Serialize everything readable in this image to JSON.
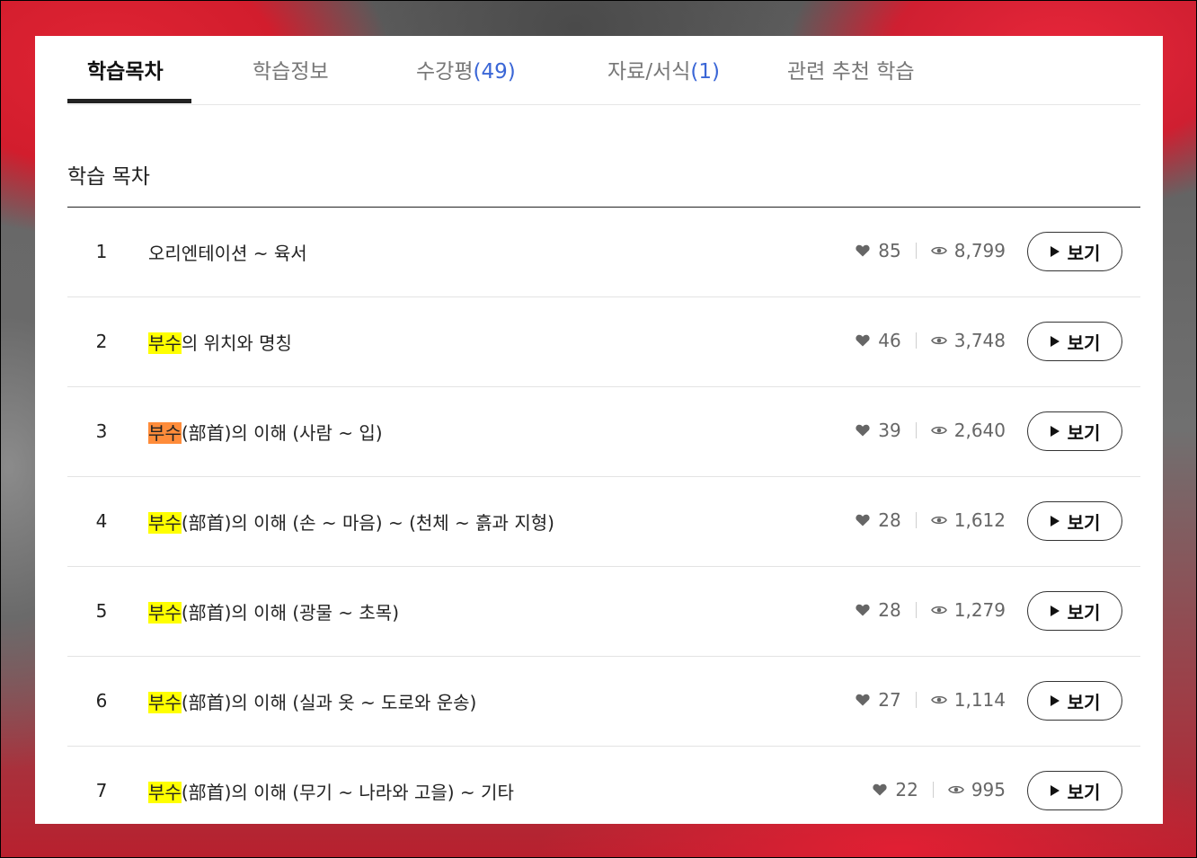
{
  "tabs": [
    {
      "label": "학습목차",
      "count": "",
      "active": true
    },
    {
      "label": "학습정보",
      "count": "",
      "active": false
    },
    {
      "label": "수강평",
      "count": "(49)",
      "active": false
    },
    {
      "label": "자료/서식",
      "count": "(1)",
      "active": false
    },
    {
      "label": "관련 추천 학습",
      "count": "",
      "active": false
    }
  ],
  "section_title": "학습 목차",
  "view_label": "보기",
  "highlight_colors": {
    "yellow": "#ffff00",
    "orange": "#ff8c3a"
  },
  "lessons": [
    {
      "num": "1",
      "hl": "",
      "hl_color": "",
      "rest": "오리엔테이션 ~ 육서",
      "likes": "85",
      "views": "8,799"
    },
    {
      "num": "2",
      "hl": "부수",
      "hl_color": "yellow",
      "rest": "의 위치와 명칭",
      "likes": "46",
      "views": "3,748"
    },
    {
      "num": "3",
      "hl": "부수",
      "hl_color": "orange",
      "rest": "(部首)의 이해 (사람 ~ 입)",
      "likes": "39",
      "views": "2,640"
    },
    {
      "num": "4",
      "hl": "부수",
      "hl_color": "yellow",
      "rest": "(部首)의 이해 (손 ~ 마음) ~ (천체 ~ 흙과 지형)",
      "likes": "28",
      "views": "1,612"
    },
    {
      "num": "5",
      "hl": "부수",
      "hl_color": "yellow",
      "rest": "(部首)의 이해 (광물 ~ 초목)",
      "likes": "28",
      "views": "1,279"
    },
    {
      "num": "6",
      "hl": "부수",
      "hl_color": "yellow",
      "rest": "(部首)의 이해 (실과 옷 ~ 도로와 운송)",
      "likes": "27",
      "views": "1,114"
    },
    {
      "num": "7",
      "hl": "부수",
      "hl_color": "yellow",
      "rest": "(部首)의 이해 (무기 ~ 나라와 고을) ~ 기타",
      "likes": "22",
      "views": "995"
    }
  ]
}
